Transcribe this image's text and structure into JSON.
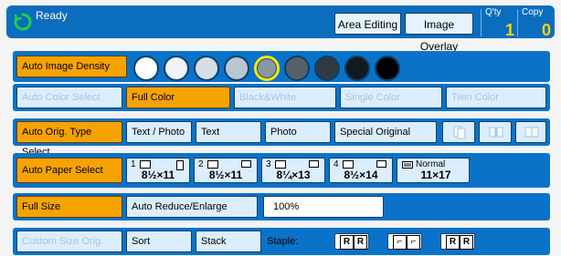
{
  "header": {
    "status": "Ready",
    "area_editing": "Area Editing",
    "image_overlay": "Image Overlay",
    "qty_label": "Q'ty",
    "qty_value": "1",
    "copy_label": "Copy",
    "copy_value": "0"
  },
  "density": {
    "label": "Auto Image Density",
    "levels": [
      {
        "color": "#ffffff"
      },
      {
        "color": "#f0f4f8"
      },
      {
        "color": "#d6dfe6"
      },
      {
        "color": "#b9c6d0"
      },
      {
        "color": "#8b98a3",
        "selected": true
      },
      {
        "color": "#55616a"
      },
      {
        "color": "#313a41"
      },
      {
        "color": "#131a1f"
      },
      {
        "color": "#000000"
      }
    ]
  },
  "color_modes": {
    "auto": "Auto Color Select",
    "full": "Full Color",
    "bw": "Black&White",
    "single": "Single Color",
    "twin": "Twin Color"
  },
  "orig_type": {
    "auto": "Auto Orig. Type Select",
    "text_photo": "Text / Photo",
    "text": "Text",
    "photo": "Photo",
    "special": "Special Original"
  },
  "paper": {
    "auto": "Auto Paper Select",
    "trays": [
      {
        "index": "1",
        "size": "8½×11"
      },
      {
        "index": "2",
        "size": "8½×11"
      },
      {
        "index": "3",
        "size": "8¼×13"
      },
      {
        "index": "4",
        "size": "8½×14"
      }
    ],
    "bypass": {
      "label": "Normal",
      "size": "11×17"
    }
  },
  "reduce": {
    "full_size": "Full Size",
    "auto_reduce": "Auto Reduce/Enlarge",
    "ratio": "100%"
  },
  "finish": {
    "custom": "Custom Size Orig.",
    "sort": "Sort",
    "stack": "Stack",
    "staple_label": "Staple:",
    "staple_opts": [
      {
        "l": "R",
        "r": "R"
      },
      {
        "l": "⌐",
        "r": "⌐"
      },
      {
        "l": "R",
        "r": "R"
      }
    ]
  }
}
